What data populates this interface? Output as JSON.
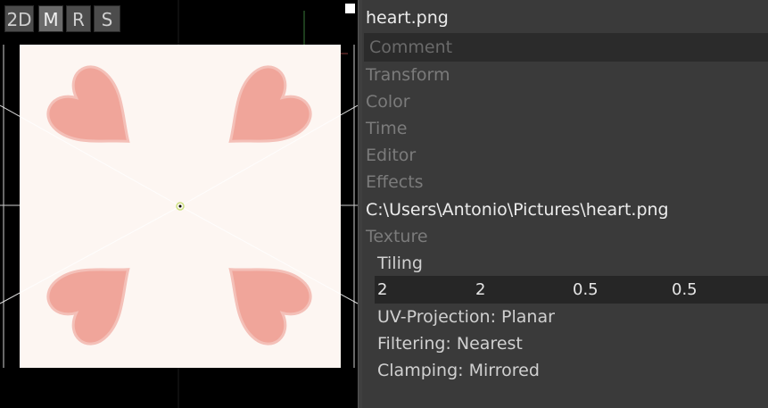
{
  "viewport": {
    "mode_buttons": [
      "2D",
      "M",
      "R",
      "S"
    ],
    "active_mode": "M",
    "texture_preview": "heart-texture-tiled-mirrored"
  },
  "inspector": {
    "filename": "heart.png",
    "comment_placeholder": "Comment",
    "sections": [
      "Transform",
      "Color",
      "Time",
      "Editor",
      "Effects"
    ],
    "path": "C:\\Users\\Antonio\\Pictures\\heart.png",
    "texture_label": "Texture",
    "tiling_label": "Tiling",
    "tiling_values": [
      "2",
      "2",
      "0.5",
      "0.5"
    ],
    "uv_projection": "UV-Projection: Planar",
    "filtering": "Filtering: Nearest",
    "clamping": "Clamping: Mirrored"
  },
  "colors": {
    "heart": "#f0a59a",
    "texture_bg": "#fdf6f2",
    "panel_bg": "#3a3a3a"
  }
}
